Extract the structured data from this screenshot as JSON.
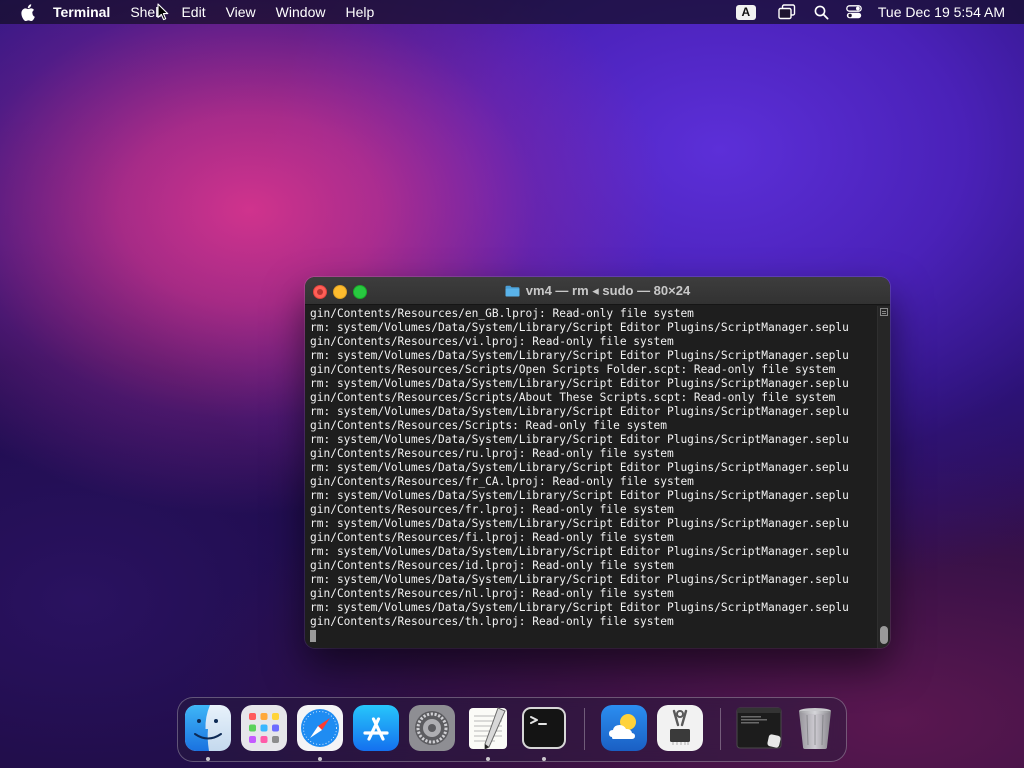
{
  "menubar": {
    "apple_icon": "apple-icon",
    "app_name": "Terminal",
    "items": [
      "Shell",
      "Edit",
      "View",
      "Window",
      "Help"
    ],
    "status": {
      "input_source": "A",
      "icons": [
        "screen-mirroring-icon",
        "spotlight-search-icon",
        "control-center-icon"
      ],
      "clock": "Tue Dec 19  5:54 AM"
    }
  },
  "terminal": {
    "title": "vm4 — rm ◂ sudo — 80×24",
    "lines": [
      "gin/Contents/Resources/en_GB.lproj: Read-only file system",
      "rm: system/Volumes/Data/System/Library/Script Editor Plugins/ScriptManager.seplu",
      "gin/Contents/Resources/vi.lproj: Read-only file system",
      "rm: system/Volumes/Data/System/Library/Script Editor Plugins/ScriptManager.seplu",
      "gin/Contents/Resources/Scripts/Open Scripts Folder.scpt: Read-only file system",
      "rm: system/Volumes/Data/System/Library/Script Editor Plugins/ScriptManager.seplu",
      "gin/Contents/Resources/Scripts/About These Scripts.scpt: Read-only file system",
      "rm: system/Volumes/Data/System/Library/Script Editor Plugins/ScriptManager.seplu",
      "gin/Contents/Resources/Scripts: Read-only file system",
      "rm: system/Volumes/Data/System/Library/Script Editor Plugins/ScriptManager.seplu",
      "gin/Contents/Resources/ru.lproj: Read-only file system",
      "rm: system/Volumes/Data/System/Library/Script Editor Plugins/ScriptManager.seplu",
      "gin/Contents/Resources/fr_CA.lproj: Read-only file system",
      "rm: system/Volumes/Data/System/Library/Script Editor Plugins/ScriptManager.seplu",
      "gin/Contents/Resources/fr.lproj: Read-only file system",
      "rm: system/Volumes/Data/System/Library/Script Editor Plugins/ScriptManager.seplu",
      "gin/Contents/Resources/fi.lproj: Read-only file system",
      "rm: system/Volumes/Data/System/Library/Script Editor Plugins/ScriptManager.seplu",
      "gin/Contents/Resources/id.lproj: Read-only file system",
      "rm: system/Volumes/Data/System/Library/Script Editor Plugins/ScriptManager.seplu",
      "gin/Contents/Resources/nl.lproj: Read-only file system",
      "rm: system/Volumes/Data/System/Library/Script Editor Plugins/ScriptManager.seplu",
      "gin/Contents/Resources/th.lproj: Read-only file system",
      ""
    ]
  },
  "dock": {
    "apps": [
      {
        "name": "finder-icon",
        "running": true
      },
      {
        "name": "launchpad-icon",
        "running": false
      },
      {
        "name": "safari-icon",
        "running": true
      },
      {
        "name": "app-store-icon",
        "running": false
      },
      {
        "name": "system-settings-icon",
        "running": false
      },
      {
        "name": "textedit-icon",
        "running": true
      },
      {
        "name": "terminal-icon",
        "running": true
      },
      {
        "name": "weather-icon",
        "running": false
      },
      {
        "name": "system-information-icon",
        "running": false
      },
      {
        "name": "minimized-window-thumbnail",
        "running": false
      },
      {
        "name": "trash-icon",
        "running": false
      }
    ]
  }
}
